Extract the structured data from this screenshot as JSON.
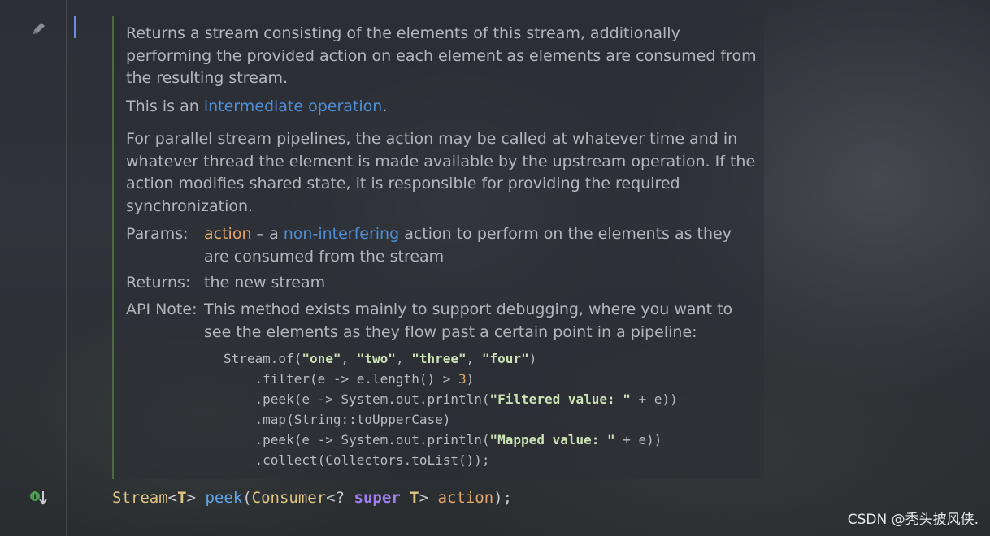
{
  "doc": {
    "summary": "Returns a stream consisting of the elements of this stream, additionally performing the provided action on each element as elements are consumed from the resulting stream.",
    "intermediate_prefix": "This is an ",
    "intermediate_link": "intermediate operation",
    "intermediate_suffix": ".",
    "parallel_note": "For parallel stream pipelines, the action may be called at whatever time and in whatever thread the element is made available by the upstream operation. If the action modifies shared state, it is responsible for providing the required synchronization.",
    "params_label": "Params:",
    "param_name": "action",
    "param_dash": " – a ",
    "param_link": "non-interfering",
    "param_rest": " action to perform on the elements as they are consumed from the stream",
    "returns_label": "Returns:",
    "returns_value": "the new stream",
    "apinote_label": "API Note:",
    "apinote_value": "This method exists mainly to support debugging, where you want to see the elements as they flow past a certain point in a pipeline:"
  },
  "code": {
    "l1_a": "Stream.of(",
    "l1_s1": "\"one\"",
    "l1_c1": ", ",
    "l1_s2": "\"two\"",
    "l1_c2": ", ",
    "l1_s3": "\"three\"",
    "l1_c3": ", ",
    "l1_s4": "\"four\"",
    "l1_end": ")",
    "l2_a": "    .filter(e -> e.length() > ",
    "l2_n": "3",
    "l2_end": ")",
    "l3_a": "    .peek(e -> System.out.println(",
    "l3_s": "\"Filtered value: \"",
    "l3_end": " + e))",
    "l4": "    .map(String::toUpperCase)",
    "l5_a": "    .peek(e -> System.out.println(",
    "l5_s": "\"Mapped value: \"",
    "l5_end": " + e))",
    "l6": "    .collect(Collectors.toList());"
  },
  "signature": {
    "type": "Stream",
    "lt1": "<",
    "generic": "T",
    "gt1": "> ",
    "method": "peek",
    "open": "(",
    "ptype": "Consumer",
    "wild": "<? ",
    "super_kw": "super",
    "space": " ",
    "generic2": "T",
    "gt2": "> ",
    "pname": "action",
    "close": ");"
  },
  "watermark": "CSDN @秃头披风侠.",
  "icons": {
    "gutter_edit": "pencil-icon",
    "gutter_impl": "implemented-arrow-icon"
  },
  "colors": {
    "link": "#4f8ed6",
    "param": "#e3a56a",
    "keyword": "#9f7ff0",
    "method": "#5fa7e8"
  }
}
